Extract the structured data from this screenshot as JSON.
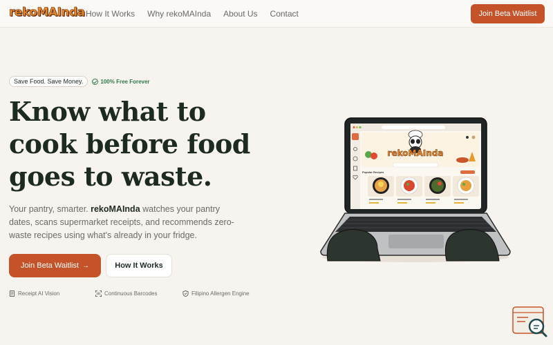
{
  "nav": {
    "logo": "rekoMAInda",
    "links": [
      "How It Works",
      "Why rekoMAInda",
      "About Us",
      "Contact"
    ],
    "cta": "Join Beta Waitlist"
  },
  "hero": {
    "badge": "Save Food. Save Money.",
    "free_badge": "100% Free Forever",
    "headline": [
      "Know what to",
      "cook before food",
      "goes to waste."
    ],
    "sub_pre": "Your pantry, smarter. ",
    "sub_brand": "rekoMAInda",
    "sub_post": " watches your pantry dates, scans supermarket receipts, and recommends zero-waste recipes using what's already in your fridge.",
    "primary_cta": "Join Beta Waitlist",
    "primary_arrow": "→",
    "secondary_cta": "How It Works",
    "features": [
      "Receipt AI Vision",
      "Continuous Barcodes",
      "Filipino Allergen Engine"
    ]
  },
  "laptop_screen": {
    "app_logo": "rekoMAInda",
    "section_title": "Popular Recipes"
  },
  "colors": {
    "accent": "#c4532a",
    "background": "#f7f4ef",
    "headline": "#1c2a22",
    "green": "#2f7a4a"
  }
}
